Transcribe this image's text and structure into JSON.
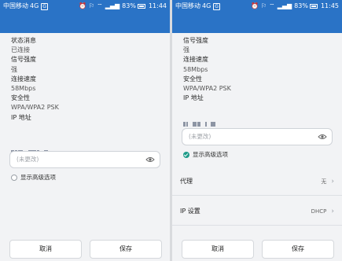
{
  "left": {
    "status": {
      "carrier": "中国移动",
      "net": "4G",
      "sim": "G",
      "battery": "83%",
      "time": "11:44"
    },
    "info_lines": [
      {
        "text": "状态消息",
        "kind": "label"
      },
      {
        "text": "已连接",
        "kind": "val"
      },
      {
        "text": "信号强度",
        "kind": "label"
      },
      {
        "text": "强",
        "kind": "val"
      },
      {
        "text": "连接速度",
        "kind": "label"
      },
      {
        "text": "58Mbps",
        "kind": "val"
      },
      {
        "text": "安全性",
        "kind": "label"
      },
      {
        "text": "WPA/WPA2 PSK",
        "kind": "val"
      },
      {
        "text": "IP 地址",
        "kind": "label"
      }
    ],
    "password_placeholder": "(未更改)",
    "advanced_label": "显示高级选项",
    "cancel_label": "取消",
    "save_label": "保存"
  },
  "right": {
    "status": {
      "carrier": "中国移动",
      "net": "4G",
      "sim": "G",
      "battery": "83%",
      "time": "11:45"
    },
    "info_lines": [
      {
        "text": "信号强度",
        "kind": "label"
      },
      {
        "text": "强",
        "kind": "val"
      },
      {
        "text": "连接速度",
        "kind": "label"
      },
      {
        "text": "58Mbps",
        "kind": "val"
      },
      {
        "text": "安全性",
        "kind": "label"
      },
      {
        "text": "WPA/WPA2 PSK",
        "kind": "val"
      },
      {
        "text": "IP 地址",
        "kind": "label"
      }
    ],
    "password_placeholder": "(未更改)",
    "advanced_label": "显示高级选项",
    "proxy_label": "代理",
    "proxy_value": "无",
    "ip_settings_label": "IP 设置",
    "ip_settings_value": "DHCP",
    "cancel_label": "取消",
    "save_label": "保存"
  },
  "colors": {
    "statusbar": "#2a73c6",
    "background": "#f2f3f5",
    "checked": "#1f9c8a"
  },
  "icons": [
    "wifi-icon",
    "alarm-icon",
    "signal-icon",
    "battery-icon",
    "eye-icon",
    "chevron-right-icon",
    "checkbox-checked-icon"
  ]
}
